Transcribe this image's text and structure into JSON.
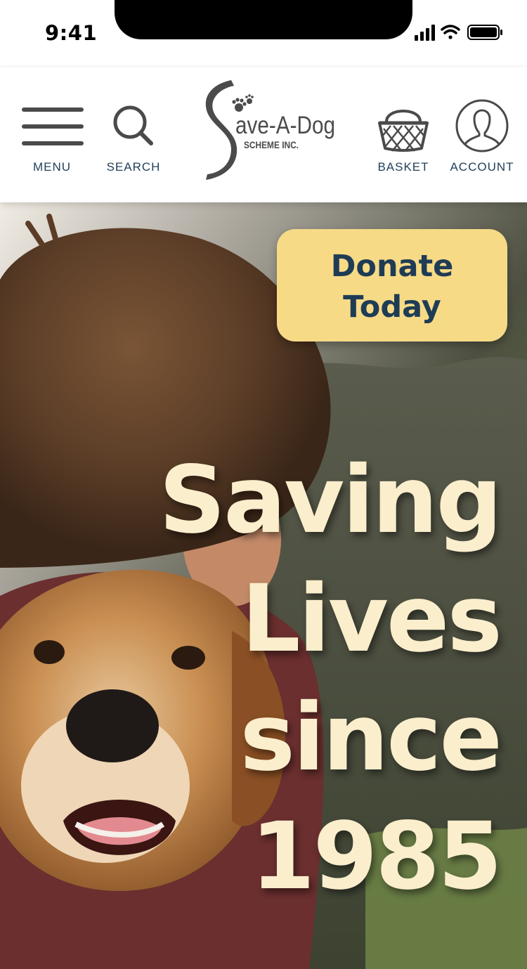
{
  "status_bar": {
    "time": "9:41",
    "icons": [
      "signal-icon",
      "wifi-icon",
      "battery-icon"
    ]
  },
  "nav": {
    "menu_label": "MENU",
    "search_label": "SEARCH",
    "basket_label": "BASKET",
    "account_label": "ACCOUNT",
    "icons": {
      "menu": "hamburger-menu-icon",
      "search": "search-icon",
      "basket": "basket-icon",
      "account": "account-icon"
    },
    "logo": {
      "name": "Save-A-Dog",
      "subtitle": "SCHEME INC.",
      "icon": "paw-print-icon"
    }
  },
  "hero": {
    "donate_label": "Donate\nToday",
    "headline": [
      "Saving",
      "Lives",
      "since",
      "1985"
    ],
    "photo_description": "hero-photo"
  },
  "colors": {
    "nav_text": "#23415a",
    "icon_stroke": "#4a4a4a",
    "donate_bg": "#f6da86",
    "donate_text": "#1f3c55",
    "headline_text": "#fbeecd"
  }
}
